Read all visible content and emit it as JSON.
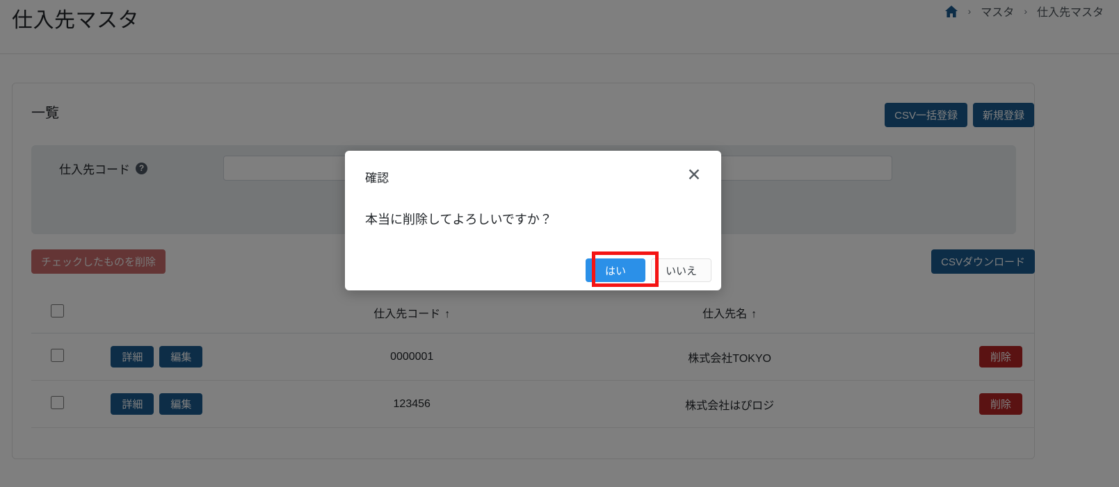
{
  "header": {
    "title": "仕入先マスタ",
    "breadcrumb": {
      "home_icon": "home-icon",
      "separator": "›",
      "items": [
        {
          "label": "マスタ"
        },
        {
          "label": "仕入先マスタ"
        }
      ]
    }
  },
  "card": {
    "title": "一覧",
    "top_actions": [
      {
        "label": "CSV一括登録",
        "style": "primary"
      },
      {
        "label": "新規登録",
        "style": "primary"
      }
    ],
    "filter": {
      "label": "仕入先コード",
      "help_icon": "question-mark-icon",
      "help_glyph": "?",
      "value": "",
      "placeholder": ""
    },
    "mid_bar": {
      "delete_checked_label": "チェックしたものを削除",
      "csv_download_label": "CSVダウンロード"
    },
    "table": {
      "columns": [
        {
          "key": "check",
          "label": ""
        },
        {
          "key": "ops",
          "label": ""
        },
        {
          "key": "code",
          "label": "仕入先コード",
          "sort": "↑"
        },
        {
          "key": "name",
          "label": "仕入先名",
          "sort": "↑"
        },
        {
          "key": "delete",
          "label": ""
        }
      ],
      "row_buttons": {
        "detail_label": "詳細",
        "edit_label": "編集",
        "delete_label": "削除"
      },
      "rows": [
        {
          "code": "0000001",
          "name": "株式会社TOKYO",
          "checked": false
        },
        {
          "code": "123456",
          "name": "株式会社はぴロジ",
          "checked": false
        }
      ],
      "select_all_checked": false
    }
  },
  "modal": {
    "title": "確認",
    "close_icon": "close-icon",
    "close_glyph": "✕",
    "message": "本当に削除してよろしいですか？",
    "confirm_label": "はい",
    "cancel_label": "いいえ",
    "highlighted_button": "confirm"
  },
  "colors": {
    "primary": "#1a5b8f",
    "danger": "#b42525",
    "danger_soft": "#c96b6b",
    "confirm_blue": "#2b90e8",
    "highlight_red": "#f41414",
    "filter_panel": "#e8ecef",
    "overlay": "rgba(0,0,0,0.5)"
  }
}
